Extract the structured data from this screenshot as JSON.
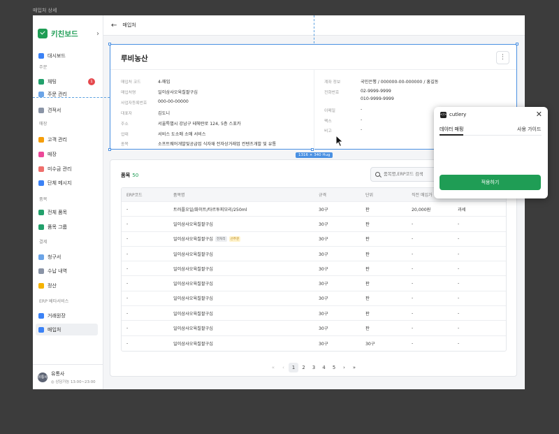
{
  "page_label": "매입처 상세",
  "sidebar": {
    "brand": "키친보드",
    "collapse_icon": "chevron-right-icon",
    "sections": [
      "주문",
      "매장",
      "품목",
      "결제",
      "ERP 베타서비스"
    ],
    "items": [
      {
        "label": "대시보드",
        "icon": "chart-icon",
        "color": "#3b82f6"
      },
      {
        "label": "채팅",
        "icon": "chat-icon",
        "color": "#22a06b",
        "badge": "1"
      },
      {
        "label": "주문 관리",
        "icon": "list-icon",
        "color": "#6ba4e7"
      },
      {
        "label": "견적서",
        "icon": "document-icon",
        "color": "#8a94a6"
      },
      {
        "label": "고객 관리",
        "icon": "people-icon",
        "color": "#f59e0b"
      },
      {
        "label": "매장",
        "icon": "store-icon",
        "color": "#ec4899"
      },
      {
        "label": "미수금 관리",
        "icon": "receivable-icon",
        "color": "#ef6f6c"
      },
      {
        "label": "단체 메시지",
        "icon": "megaphone-icon",
        "color": "#3b82f6"
      },
      {
        "label": "전체 품목",
        "icon": "box-icon",
        "color": "#22a06b"
      },
      {
        "label": "품목 그룹",
        "icon": "group-icon",
        "color": "#22a06b"
      },
      {
        "label": "청구서",
        "icon": "invoice-icon",
        "color": "#6ba4e7"
      },
      {
        "label": "수납 내역",
        "icon": "receipt-icon",
        "color": "#8a94a6"
      },
      {
        "label": "정산",
        "icon": "coin-icon",
        "color": "#f5b301"
      },
      {
        "label": "거래원장",
        "icon": "ledger-icon",
        "color": "#3b82f6"
      },
      {
        "label": "매입처",
        "icon": "truck-icon",
        "color": "#3b82f6"
      }
    ],
    "user": {
      "name": "유통사",
      "avatar_text": "유통사",
      "status": "◎ 상담가능 13:00~23:00"
    }
  },
  "header": {
    "title": "매입처",
    "back_icon": "back-arrow-icon"
  },
  "vendor": {
    "name": "루비농산",
    "more_icon": "more-vertical-icon",
    "left_fields": [
      {
        "label": "매입처 코드",
        "value": "4-매입"
      },
      {
        "label": "매입처명",
        "value": "일이삼사오육칠팔구십"
      },
      {
        "label": "사업자등록번호",
        "value": "000-00-00000"
      },
      {
        "label": "대표자",
        "value": "김도니"
      },
      {
        "label": "주소",
        "value": "서울특별시 강남구 테헤란로 124, 5층 스포카"
      },
      {
        "label": "업태",
        "value": "서비스 도소매 소매 서비스"
      },
      {
        "label": "종목",
        "value": "소프트웨어개발및공급업 식자재 전자상거래업 컨텐츠개발 및 유통"
      }
    ],
    "right_fields": [
      {
        "label": "계좌 정보",
        "value": "국민은행 / 000000-00-000000 / 홍길동"
      },
      {
        "label": "전화번호",
        "value": "02-9999-9999",
        "value2": "010-9999-9999"
      },
      {
        "label": "이메일",
        "value": "-"
      },
      {
        "label": "팩스",
        "value": "-"
      },
      {
        "label": "비고",
        "value": "-"
      }
    ],
    "selection_size": "1316 × 340 Hug"
  },
  "items": {
    "title": "품목",
    "count": "50",
    "search_placeholder": "품목명,ERP코드 검색",
    "columns": [
      "ERP코드",
      "품목명",
      "규격",
      "단위",
      "직전 매입가",
      ""
    ],
    "rows": [
      {
        "erp": "-",
        "name": "트러플오일/화이트/타르투피모리/250ml",
        "spec": "30구",
        "unit": "판",
        "price": "20,000원",
        "tax": "과세"
      },
      {
        "erp": "-",
        "name": "일이삼사오육칠팔구십",
        "spec": "30구",
        "unit": "판",
        "price": "-",
        "tax": "-"
      },
      {
        "erp": "-",
        "name": "일이삼사오육칠팔구십",
        "tags": [
          "전처리",
          "선주문"
        ],
        "spec": "30구",
        "unit": "판",
        "price": "-",
        "tax": "-"
      },
      {
        "erp": "-",
        "name": "일이삼사오육칠팔구십",
        "spec": "30구",
        "unit": "판",
        "price": "-",
        "tax": "-"
      },
      {
        "erp": "-",
        "name": "일이삼사오육칠팔구십",
        "spec": "30구",
        "unit": "판",
        "price": "-",
        "tax": "-"
      },
      {
        "erp": "-",
        "name": "일이삼사오육칠팔구십",
        "spec": "30구",
        "unit": "판",
        "price": "-",
        "tax": "-"
      },
      {
        "erp": "-",
        "name": "일이삼사오육칠팔구십",
        "spec": "30구",
        "unit": "판",
        "price": "-",
        "tax": "-"
      },
      {
        "erp": "-",
        "name": "일이삼사오육칠팔구십",
        "spec": "30구",
        "unit": "판",
        "price": "-",
        "tax": "-"
      },
      {
        "erp": "-",
        "name": "일이삼사오육칠팔구십",
        "spec": "30구",
        "unit": "판",
        "price": "-",
        "tax": "-"
      },
      {
        "erp": "-",
        "name": "일이삼사오육칠팔구십",
        "spec": "30구",
        "unit": "30구",
        "price": "-",
        "tax": "-"
      }
    ],
    "pagination": {
      "first": "«",
      "prev": "‹",
      "pages": [
        "1",
        "2",
        "3",
        "4",
        "5"
      ],
      "current": "1",
      "next": "›",
      "last": "»"
    }
  },
  "plugin": {
    "name": "cutlery",
    "logo_text": "</>",
    "close": "✕",
    "tabs": [
      "데이터 매핑",
      "사용 가이드"
    ],
    "active_tab": "데이터 매핑",
    "apply_label": "적용하기"
  }
}
